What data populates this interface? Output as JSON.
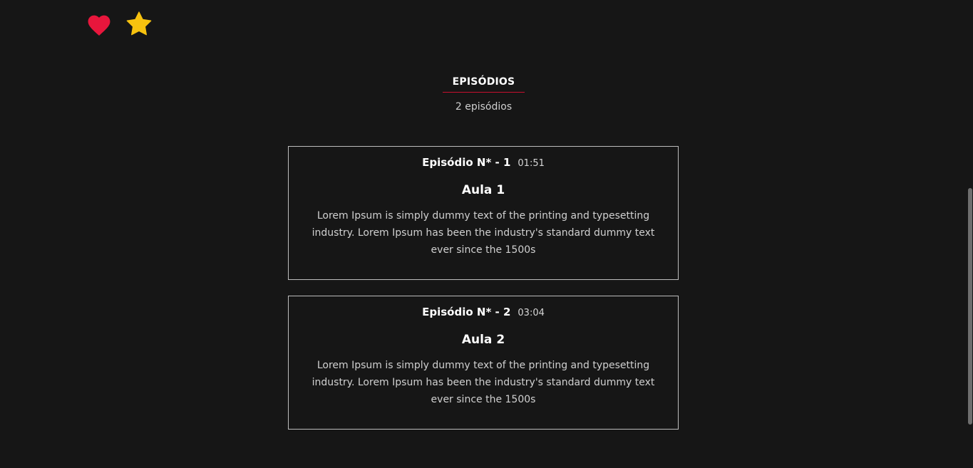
{
  "actions": {
    "favorite_icon": "heart-icon",
    "favorite_color": "#e8163c",
    "rate_icon": "star-icon",
    "rate_color": "#f7c20f"
  },
  "episodes_section": {
    "title": "EPISÓDIOS",
    "count_text": "2 episódios",
    "accent_color": "#c8102e"
  },
  "episodes": [
    {
      "number_label": "Episódio N* - 1",
      "duration": "01:51",
      "title": "Aula 1",
      "description": "Lorem Ipsum is simply dummy text of the printing and typesetting industry. Lorem Ipsum has been the industry's standard dummy text ever since the 1500s"
    },
    {
      "number_label": "Episódio N* - 2",
      "duration": "03:04",
      "title": "Aula 2",
      "description": "Lorem Ipsum is simply dummy text of the printing and typesetting industry. Lorem Ipsum has been the industry's standard dummy text ever since the 1500s"
    }
  ]
}
